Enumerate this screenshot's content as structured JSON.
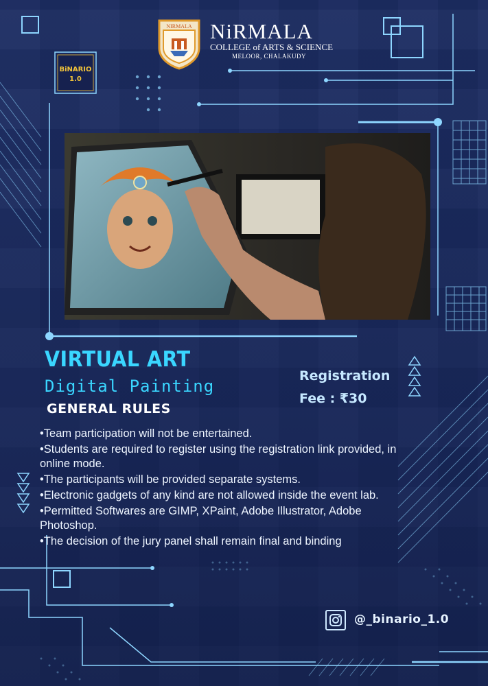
{
  "header": {
    "college_name": "NiRMALA",
    "college_subtitle": "COLLEGE of ARTS & SCIENCE",
    "college_location": "MELOOR, CHALAKUDY",
    "crest_text": "NIRMALA",
    "binario_logo_line1": "BiNARIO",
    "binario_logo_line2": "1.0"
  },
  "event": {
    "title": "VIRTUAL ART",
    "subtitle": "Digital Painting",
    "rules_heading": "GENERAL RULES",
    "registration_line1": "Registration",
    "registration_line2": "Fee : ₹30"
  },
  "rules": [
    "•Team participation will not be entertained.",
    "•Students are required to register using the registration link provided, in online mode.",
    "•The participants will be provided separate systems.",
    "•Electronic gadgets of any kind are not allowed inside the event lab.",
    "•Permitted Softwares are GIMP, XPaint, Adobe Illustrator, Adobe Photoshop.",
    "•The decision of the jury panel shall remain final and binding"
  ],
  "social": {
    "icon": "instagram-icon",
    "handle": "@_binario_1.0"
  },
  "colors": {
    "background": "#1c2c62",
    "accent": "#3ad6ff",
    "line": "#8ed6ff"
  }
}
